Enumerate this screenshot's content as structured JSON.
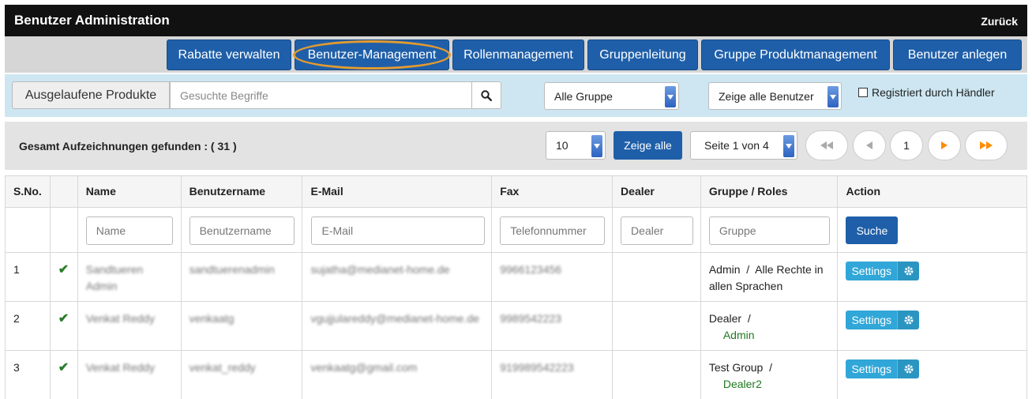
{
  "header": {
    "title": "Benutzer Administration",
    "back_label": "Zurück"
  },
  "nav": {
    "buttons": [
      {
        "label": "Rabatte verwalten"
      },
      {
        "label": "Benutzer-Management"
      },
      {
        "label": "Rollenmanagement"
      },
      {
        "label": "Gruppenleitung"
      },
      {
        "label": "Gruppe Produktmanagement"
      },
      {
        "label": "Benutzer anlegen"
      }
    ],
    "highlighted": "Benutzer-Management",
    "highlight_color": "#e39b2f"
  },
  "filters": {
    "expired_products_label": "Ausgelaufene Produkte",
    "search_placeholder": "Gesuchte Begriffe",
    "group_select": "Alle Gruppe",
    "user_select": "Zeige alle Benutzer",
    "registered_by_dealer_label": "Registriert durch Händler"
  },
  "records": {
    "total_label": "Gesamt Aufzeichnungen gefunden : ( 31 )",
    "per_page": "10",
    "show_all_label": "Zeige alle",
    "page_select": "Seite 1 von 4",
    "current_page": "1"
  },
  "table": {
    "headers": [
      "S.No.",
      "",
      "Name",
      "Benutzername",
      "E-Mail",
      "Fax",
      "Dealer",
      "Gruppe / Roles",
      "Action"
    ],
    "filter_placeholders": {
      "name": "Name",
      "username": "Benutzername",
      "email": "E-Mail",
      "fax": "Telefonnummer",
      "dealer": "Dealer",
      "group": "Gruppe"
    },
    "search_button": "Suche",
    "settings_label": "Settings",
    "rows": [
      {
        "sno": "1",
        "name": "Sandtueren Admin",
        "username": "sandtuerenadmin",
        "email": "sujatha@medianet-home.de",
        "fax": "9966123456",
        "dealer": "",
        "group": "Admin  /  Alle Rechte in allen Sprachen",
        "group_sub": ""
      },
      {
        "sno": "2",
        "name": "Venkat Reddy",
        "username": "venkaatg",
        "email": "vgujjulareddy@medianet-home.de",
        "fax": "9989542223",
        "dealer": "",
        "group": "Dealer  /",
        "group_sub": "Admin"
      },
      {
        "sno": "3",
        "name": "Venkat Reddy",
        "username": "venkat_reddy",
        "email": "venkaatg@gmail.com",
        "fax": "919989542223",
        "dealer": "",
        "group": "Test Group  /",
        "group_sub": "Dealer2"
      }
    ]
  },
  "colors": {
    "primary": "#1f5fa9",
    "settings": "#30a7d8",
    "header_bg": "#111111",
    "filter_bg": "#cde6f1",
    "check": "#2a7d2a",
    "pager_accent": "#ff8c00"
  }
}
